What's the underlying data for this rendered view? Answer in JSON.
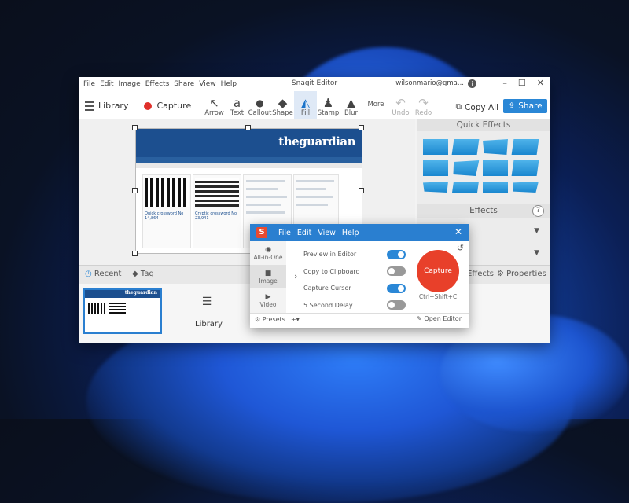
{
  "app": {
    "title": "Snagit Editor",
    "account": "wilsonmario@gma...",
    "menu": [
      "File",
      "Edit",
      "Image",
      "Effects",
      "Share",
      "View",
      "Help"
    ]
  },
  "toolbar": {
    "library": "Library",
    "capture": "Capture",
    "tools": [
      {
        "label": "Arrow",
        "icon": "arrow-icon",
        "glyph": "↖"
      },
      {
        "label": "Text",
        "icon": "text-icon",
        "glyph": "a"
      },
      {
        "label": "Callout",
        "icon": "callout-icon",
        "glyph": "💬"
      },
      {
        "label": "Shape",
        "icon": "shape-icon",
        "glyph": "◆"
      },
      {
        "label": "Fill",
        "icon": "fill-icon",
        "glyph": "🖌"
      },
      {
        "label": "Stamp",
        "icon": "stamp-icon",
        "glyph": "♟"
      },
      {
        "label": "Blur",
        "icon": "blur-icon",
        "glyph": "💧"
      }
    ],
    "more": "More",
    "undo": "Undo",
    "redo": "Redo",
    "copy_all": "Copy All",
    "share": "Share"
  },
  "canvas": {
    "logo": "theguardian",
    "crossword1": "Quick crossword No 14,864",
    "crossword2": "Cryptic crossword No 23,941"
  },
  "right_panel": {
    "quick_effects": "Quick Effects",
    "effects": "Effects",
    "help": "?"
  },
  "bottom": {
    "recent": "Recent",
    "tag": "Tag",
    "effects": "Effects",
    "properties": "Properties",
    "library": "Library"
  },
  "capture_window": {
    "menu": [
      "File",
      "Edit",
      "View",
      "Help"
    ],
    "modes": [
      "All-in-One",
      "Image",
      "Video"
    ],
    "options": [
      {
        "label": "Preview in Editor",
        "on": true
      },
      {
        "label": "Copy to Clipboard",
        "on": false
      },
      {
        "label": "Capture Cursor",
        "on": true
      },
      {
        "label": "5 Second Delay",
        "on": false
      }
    ],
    "capture_button": "Capture",
    "shortcut": "Ctrl+Shift+C",
    "presets": "Presets",
    "open_editor": "Open Editor"
  },
  "colors": {
    "accent": "#2a87d6",
    "capture": "#e8402a"
  }
}
